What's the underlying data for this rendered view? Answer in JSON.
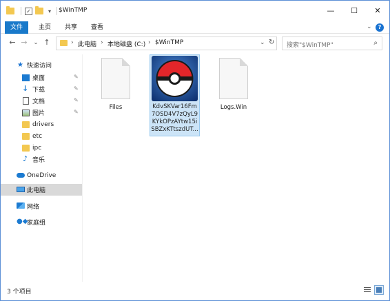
{
  "window": {
    "title": "$WinTMP",
    "controls": {
      "minimize": "—",
      "maximize": "☐",
      "close": "✕"
    }
  },
  "quick_access_toolbar": {
    "separator_arrow": "▾"
  },
  "ribbon": {
    "tabs": [
      "文件",
      "主页",
      "共享",
      "查看"
    ],
    "expand_glyph": "⌄",
    "help_glyph": "?"
  },
  "nav": {
    "back": "←",
    "forward": "→",
    "recent": "⌄",
    "up": "↑",
    "breadcrumb": [
      "此电脑",
      "本地磁盘 (C:)",
      "$WinTMP"
    ],
    "chevron": "›",
    "dropdown": "⌄",
    "refresh": "↻"
  },
  "search": {
    "placeholder": "搜索\"$WinTMP\"",
    "icon_glyph": "⌕"
  },
  "sidebar": {
    "items": [
      {
        "label": "快速访问",
        "icon": "star-icon"
      },
      {
        "label": "桌面",
        "icon": "desktop-icon",
        "pinned": true
      },
      {
        "label": "下载",
        "icon": "download-icon",
        "pinned": true
      },
      {
        "label": "文档",
        "icon": "document-icon",
        "pinned": true
      },
      {
        "label": "图片",
        "icon": "pictures-icon",
        "pinned": true
      },
      {
        "label": "drivers",
        "icon": "folder-icon"
      },
      {
        "label": "etc",
        "icon": "folder-icon"
      },
      {
        "label": "ipc",
        "icon": "folder-icon"
      },
      {
        "label": "音乐",
        "icon": "music-icon"
      },
      {
        "label": "OneDrive",
        "icon": "cloud-icon"
      },
      {
        "label": "此电脑",
        "icon": "computer-icon",
        "selected": true
      },
      {
        "label": "网络",
        "icon": "network-icon"
      },
      {
        "label": "家庭组",
        "icon": "homegroup-icon"
      }
    ],
    "pin_glyph": "📌"
  },
  "files": [
    {
      "name": "Files",
      "type": "file"
    },
    {
      "name_lines": [
        "KdvSKVar16Fm",
        "7OSD4V7zQyL9",
        "KYkOPzAYtw15i",
        "SBZxKTtszdUT..."
      ],
      "type": "image",
      "selected": true
    },
    {
      "name": "Logs.Win",
      "type": "file"
    }
  ],
  "status": {
    "item_count": "3 个项目"
  },
  "colors": {
    "accent": "#1979ca",
    "selection": "#cce4f7",
    "folder": "#f3c851"
  }
}
